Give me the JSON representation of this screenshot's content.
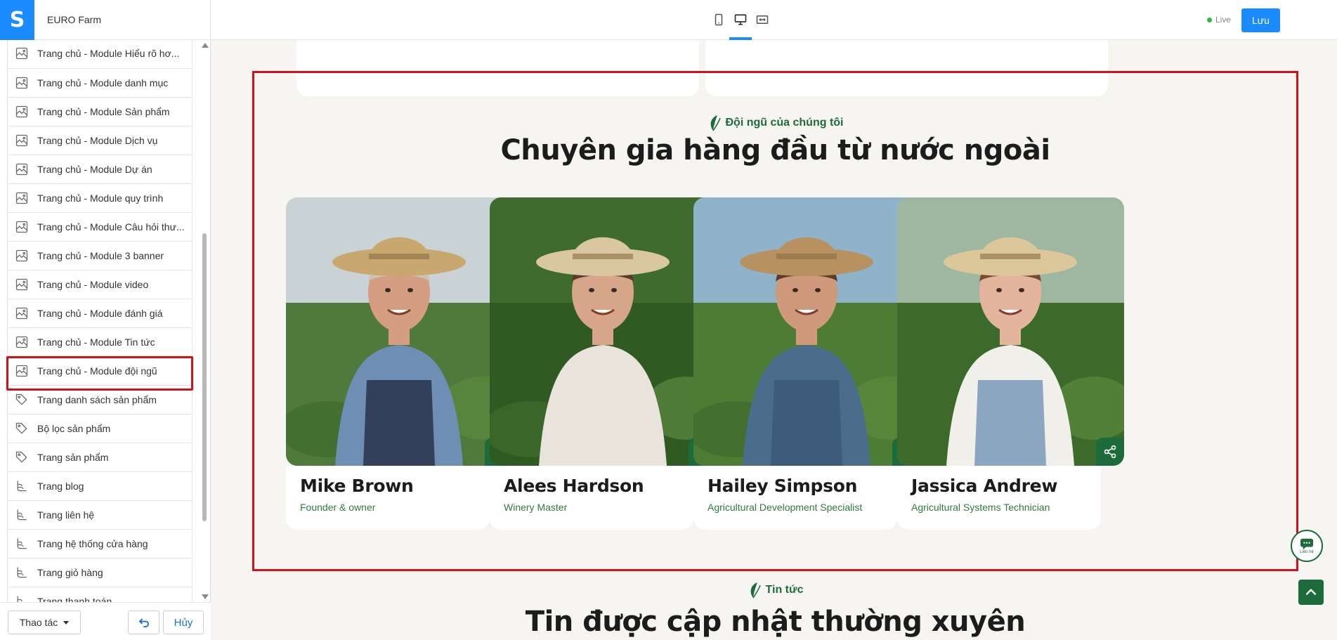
{
  "app": {
    "site_name": "EURO Farm",
    "logo_letter": "S",
    "status": "Live",
    "save_label": "Lưu"
  },
  "sidebar": {
    "items": [
      {
        "label": "Trang chủ - Module Hiểu rõ hơ...",
        "icon": "page-layout-icon"
      },
      {
        "label": "Trang chủ - Module danh mục",
        "icon": "page-layout-icon"
      },
      {
        "label": "Trang chủ - Module Sản phẩm",
        "icon": "page-layout-icon"
      },
      {
        "label": "Trang chủ - Module Dịch vụ",
        "icon": "page-layout-icon"
      },
      {
        "label": "Trang chủ - Module Dự án",
        "icon": "page-layout-icon"
      },
      {
        "label": "Trang chủ - Module quy trình",
        "icon": "page-layout-icon"
      },
      {
        "label": "Trang chủ - Module Câu hỏi thư...",
        "icon": "page-layout-icon"
      },
      {
        "label": "Trang chủ - Module 3 banner",
        "icon": "page-layout-icon"
      },
      {
        "label": "Trang chủ - Module video",
        "icon": "page-layout-icon"
      },
      {
        "label": "Trang chủ - Module đánh giá",
        "icon": "page-layout-icon"
      },
      {
        "label": "Trang chủ - Module Tin tức",
        "icon": "page-layout-icon"
      },
      {
        "label": "Trang chủ - Module đội ngũ",
        "icon": "page-layout-icon",
        "selected": true
      },
      {
        "label": "Trang danh sách sản phẩm",
        "icon": "tag-icon"
      },
      {
        "label": "Bộ lọc sản phẩm",
        "icon": "tag-icon"
      },
      {
        "label": "Trang sản phẩm",
        "icon": "tag-icon"
      },
      {
        "label": "Trang blog",
        "icon": "blog-icon"
      },
      {
        "label": "Trang liên hệ",
        "icon": "blog-icon"
      },
      {
        "label": "Trang hệ thống cửa hàng",
        "icon": "blog-icon"
      },
      {
        "label": "Trang giỏ hàng",
        "icon": "blog-icon"
      },
      {
        "label": "Trang thanh toán",
        "icon": "blog-icon"
      }
    ],
    "action_label": "Thao tác",
    "cancel_label": "Hủy"
  },
  "team_section": {
    "eyebrow": "Đội ngũ của chúng tôi",
    "title": "Chuyên gia hàng đầu từ nước ngoài",
    "members": [
      {
        "name": "Mike Brown",
        "role": "Founder & owner"
      },
      {
        "name": "Alees Hardson",
        "role": "Winery Master"
      },
      {
        "name": "Hailey Simpson",
        "role": "Agricultural Development Specialist"
      },
      {
        "name": "Jassica Andrew",
        "role": "Agricultural Systems Technician"
      }
    ]
  },
  "news_section": {
    "eyebrow": "Tin tức",
    "title": "Tin được cập nhật thường xuyên"
  },
  "float": {
    "chat_label": "Liên hệ"
  },
  "colors": {
    "brand_blue": "#1a8cff",
    "selection_red": "#d0121b",
    "farm_green": "#1d6b3a",
    "role_green": "#2f7d3e"
  }
}
